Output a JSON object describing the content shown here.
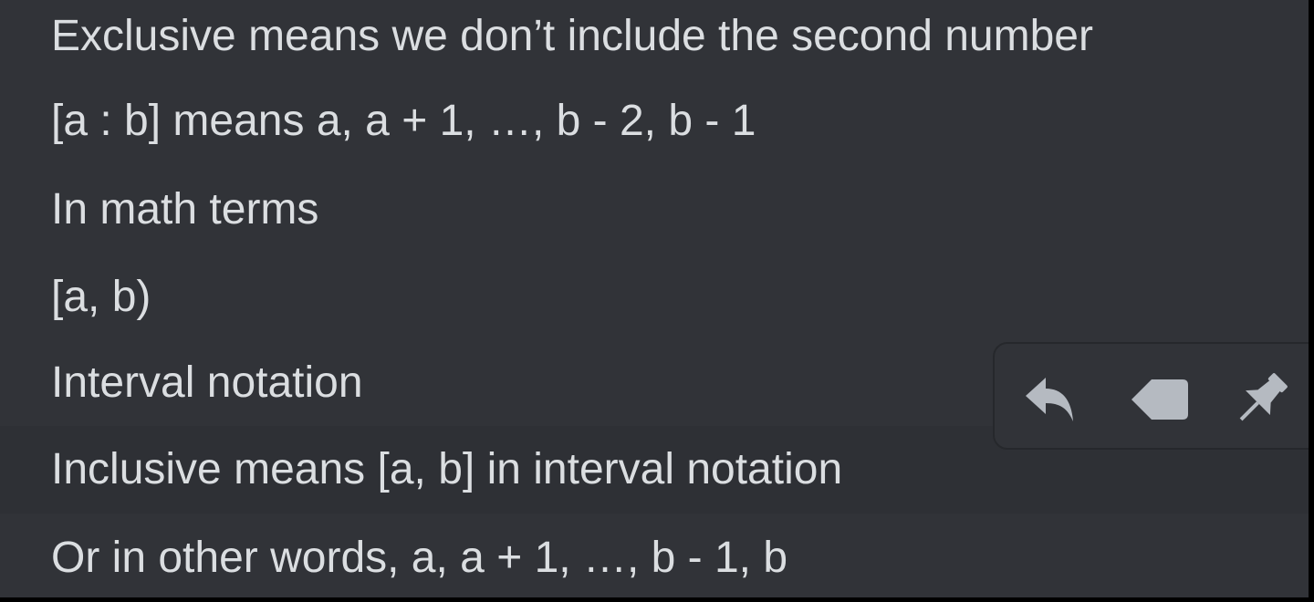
{
  "messages": [
    {
      "text": "Exclusive means we don’t include the second number"
    },
    {
      "text": "[a : b] means a, a + 1, …, b - 2, b - 1"
    },
    {
      "text": "In math terms"
    },
    {
      "text": "[a, b)"
    },
    {
      "text": "Interval notation"
    },
    {
      "text": "Inclusive means [a, b] in interval notation"
    },
    {
      "text": "Or in other words, a, a + 1, …, b - 1, b"
    }
  ],
  "toolbar": {
    "icons": [
      "reply-icon",
      "tag-icon",
      "pin-icon"
    ]
  },
  "colors": {
    "background": "#313338",
    "hover_background": "#2e3035",
    "text": "#dbdee1",
    "icon": "#b5bac1"
  }
}
